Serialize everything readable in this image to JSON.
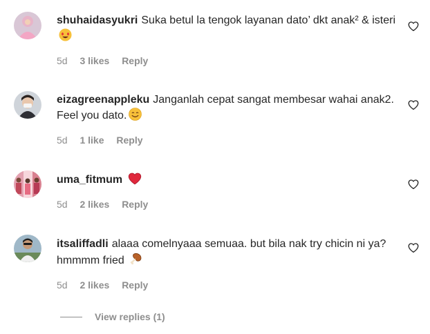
{
  "comments": [
    {
      "username": "shuhaidasyukri",
      "text": "Suka betul la tengok layanan dato’ dkt anak² & isteri",
      "emoji_icon": "heart-eyes-emoji",
      "age": "5d",
      "likes": "3 likes",
      "reply": "Reply"
    },
    {
      "username": "eizagreenappleku",
      "text": "Janganlah cepat sangat membesar wahai anak2. Feel you dato.",
      "emoji_icon": "smiling-face-emoji",
      "age": "5d",
      "likes": "1 like",
      "reply": "Reply"
    },
    {
      "username": "uma_fitmum",
      "text": "",
      "emoji_icon": "red-heart-emoji",
      "age": "5d",
      "likes": "2 likes",
      "reply": "Reply"
    },
    {
      "username": "itsaliffadli",
      "text": "alaaa comelnyaaa semuaa. but bila nak try chicin ni ya? hmmmm fried",
      "emoji_icon": "poultry-leg-emoji",
      "age": "5d",
      "likes": "2 likes",
      "reply": "Reply"
    }
  ],
  "view_replies": "View replies (1)",
  "colors": {
    "text": "#262626",
    "meta": "#8e8e8e",
    "heart_outline": "#262626"
  }
}
